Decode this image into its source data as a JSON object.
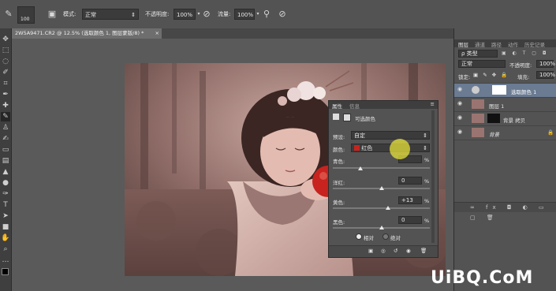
{
  "options_bar": {
    "brush_size": "100",
    "mode_label": "模式:",
    "mode_value": "正常",
    "opacity_label": "不透明度:",
    "opacity_value": "100%",
    "flow_label": "流量:",
    "flow_value": "100%"
  },
  "document_tab": {
    "title": "2W5A9471.CR2 @ 12.5% (选取颜色 1, 图层蒙版/8) *",
    "close": "×"
  },
  "properties_panel": {
    "tabs": [
      "属性",
      "信息"
    ],
    "title": "可选颜色",
    "preset_label": "预设:",
    "preset_value": "自定",
    "colors_label": "颜色:",
    "colors_value": "红色",
    "sliders": [
      {
        "label": "青色:",
        "value": "",
        "unit": "%"
      },
      {
        "label": "洋红:",
        "value": "0",
        "unit": "%"
      },
      {
        "label": "黄色:",
        "value": "+13",
        "unit": "%"
      },
      {
        "label": "黑色:",
        "value": "0",
        "unit": "%"
      }
    ],
    "method_relative": "相对",
    "method_absolute": "绝对"
  },
  "right_panel": {
    "tabs": [
      "图层",
      "通道",
      "路径",
      "动作",
      "历史记录"
    ],
    "kind_label": "ρ 类型",
    "blend_value": "正常",
    "opacity_label": "不透明度:",
    "opacity_value": "100%",
    "lock_label": "锁定:",
    "fill_label": "填充:",
    "fill_value": "100%",
    "layers": [
      {
        "name": "选取颜色 1"
      },
      {
        "name": "图层 1"
      },
      {
        "name": "背景 拷贝"
      },
      {
        "name": "背景"
      }
    ]
  },
  "watermark": "UiBQ.CoM",
  "colors": {
    "accent_highlight": "#e6e23a",
    "red_swatch": "#c8231e"
  }
}
